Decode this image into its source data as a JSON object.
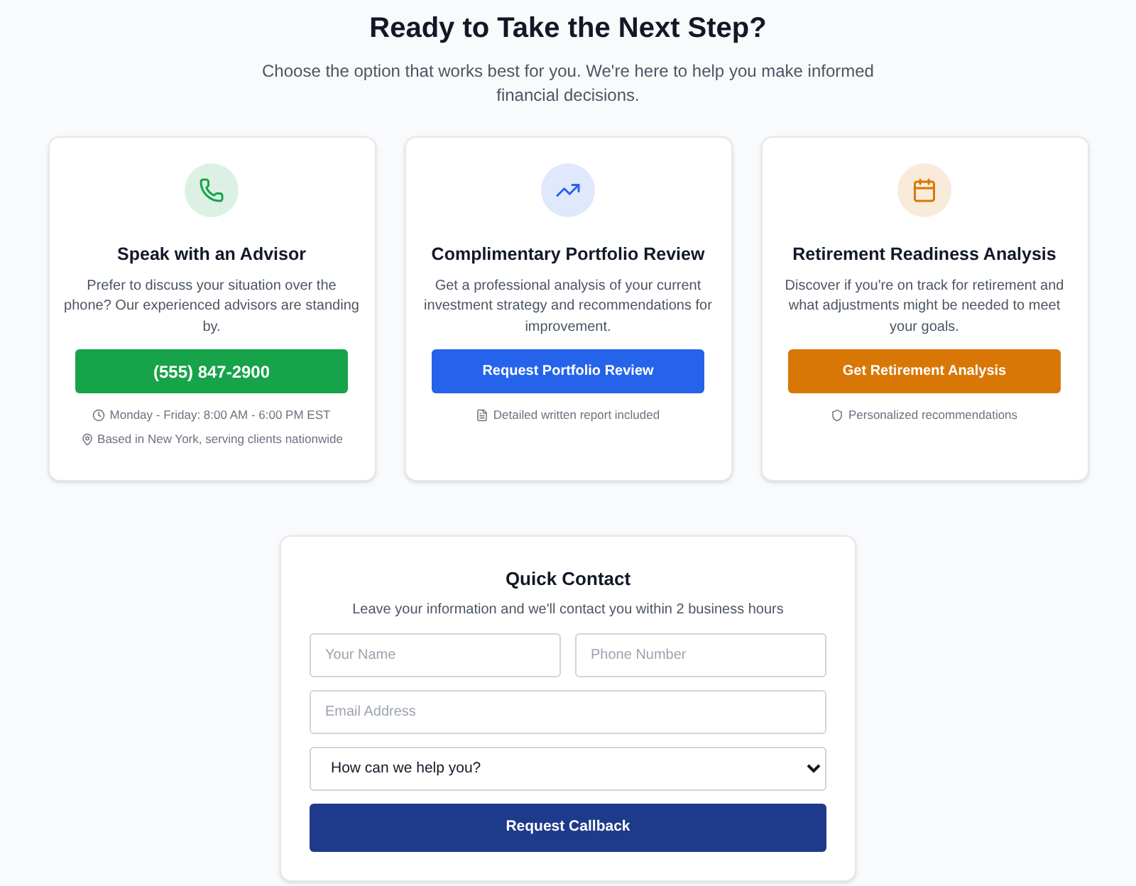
{
  "header": {
    "title": "Ready to Take the Next Step?",
    "subtitle": "Choose the option that works best for you. We're here to help you make informed financial decisions."
  },
  "cards": [
    {
      "kind": "phone",
      "color": "#16a34a",
      "title": "Speak with an Advisor",
      "description": "Prefer to discuss your situation over the phone? Our experienced advisors are standing by.",
      "button": "(555) 847-2900",
      "notes": [
        {
          "kind": "clock",
          "text": "Monday - Friday: 8:00 AM - 6:00 PM EST"
        },
        {
          "kind": "pin",
          "text": "Based in New York, serving clients nationwide"
        }
      ]
    },
    {
      "kind": "trend",
      "color": "#2563eb",
      "title": "Complimentary Portfolio Review",
      "description": "Get a professional analysis of your current investment strategy and recommendations for improvement.",
      "button": "Request Portfolio Review",
      "notes": [
        {
          "kind": "file",
          "text": "Detailed written report included"
        }
      ]
    },
    {
      "kind": "calendar",
      "color": "#d97706",
      "title": "Retirement Readiness Analysis",
      "description": "Discover if you're on track for retirement and what adjustments might be needed to meet your goals.",
      "button": "Get Retirement Analysis",
      "notes": [
        {
          "kind": "shield",
          "text": "Personalized recommendations"
        }
      ]
    }
  ],
  "quick_contact": {
    "title": "Quick Contact",
    "subtitle": "Leave your information and we'll contact you within 2 business hours",
    "name": {
      "placeholder": "Your Name"
    },
    "phone": {
      "placeholder": "Phone Number"
    },
    "email": {
      "placeholder": "Email Address"
    },
    "topic": {
      "value": "How can we help you?"
    },
    "button": "Request Callback"
  }
}
